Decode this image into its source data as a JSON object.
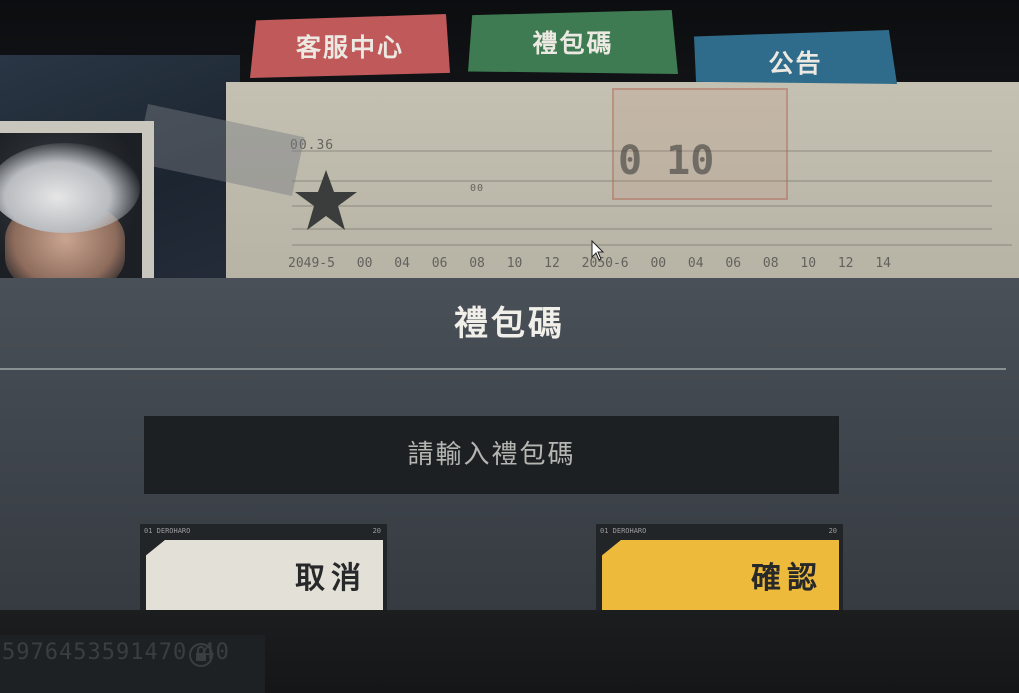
{
  "tabs": {
    "service": "客服中心",
    "gift_code": "禮包碼",
    "notice": "公告"
  },
  "background": {
    "doc_code": "00.36",
    "doc_mid": "00",
    "stamp_text": "0 10",
    "timeline": "2049-5 00 04 06 08 10 12 2050-6 00 04 06 08 10 12 14"
  },
  "dialog": {
    "title": "禮包碼",
    "input_placeholder": "請輸入禮包碼",
    "input_value": ""
  },
  "buttons": {
    "strip_label": "01 DEROHARO",
    "strip_number": "20",
    "cancel_label": "取消",
    "confirm_label": "確認"
  },
  "footer": {
    "user_id": "5976453591470 40"
  },
  "colors": {
    "tab_service": "#c0595a",
    "tab_gift_code": "#3e7a52",
    "tab_notice": "#2f6b8a",
    "confirm_button": "#eeba3c",
    "cancel_button": "#e3e0d8"
  },
  "icons": {
    "star": "star-emblem-icon",
    "cursor": "mouse-cursor-icon",
    "lock": "lock-icon"
  }
}
